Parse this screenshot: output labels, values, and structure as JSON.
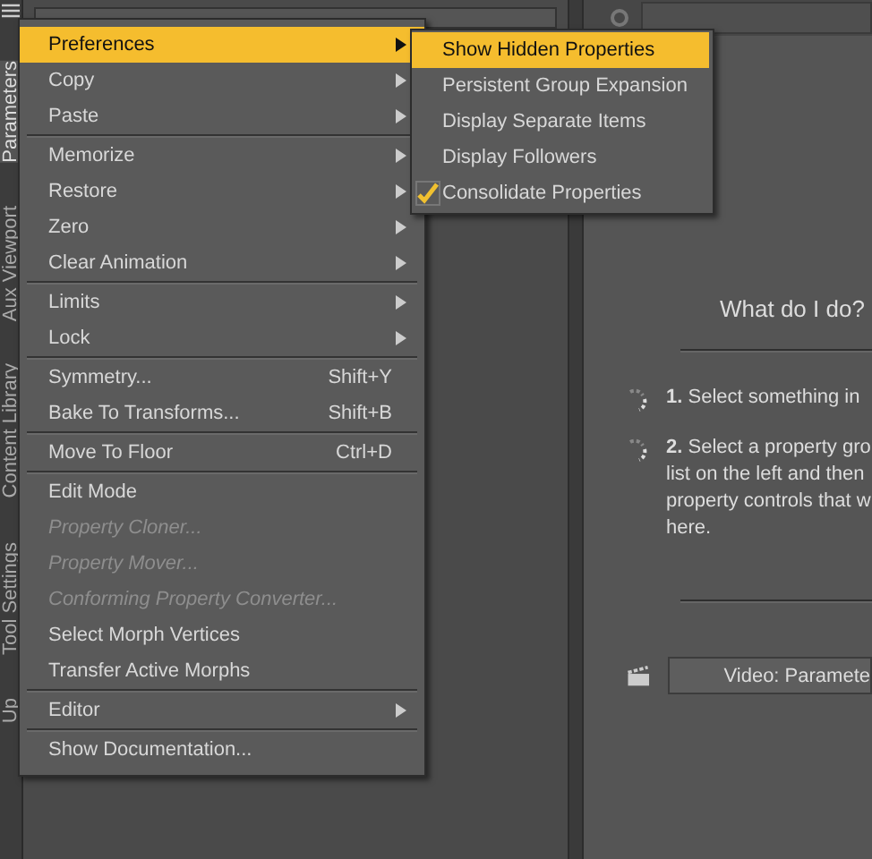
{
  "side_tabs": [
    {
      "label": "Parameters",
      "selected": true
    },
    {
      "label": "Aux Viewport",
      "selected": false
    },
    {
      "label": "Content Library",
      "selected": false
    },
    {
      "label": "Tool Settings",
      "selected": false
    },
    {
      "label": "Up",
      "selected": false
    }
  ],
  "menu": [
    {
      "kind": "item",
      "label": "Preferences",
      "submenu": true,
      "selected": true,
      "disabled": false
    },
    {
      "kind": "item",
      "label": "Copy",
      "submenu": true,
      "selected": false,
      "disabled": false
    },
    {
      "kind": "item",
      "label": "Paste",
      "submenu": true,
      "selected": false,
      "disabled": false
    },
    {
      "kind": "separator"
    },
    {
      "kind": "item",
      "label": "Memorize",
      "submenu": true,
      "selected": false,
      "disabled": false
    },
    {
      "kind": "item",
      "label": "Restore",
      "submenu": true,
      "selected": false,
      "disabled": false
    },
    {
      "kind": "item",
      "label": "Zero",
      "submenu": true,
      "selected": false,
      "disabled": false
    },
    {
      "kind": "item",
      "label": "Clear Animation",
      "submenu": true,
      "selected": false,
      "disabled": false
    },
    {
      "kind": "separator"
    },
    {
      "kind": "item",
      "label": "Limits",
      "submenu": true,
      "selected": false,
      "disabled": false
    },
    {
      "kind": "item",
      "label": "Lock",
      "submenu": true,
      "selected": false,
      "disabled": false
    },
    {
      "kind": "separator"
    },
    {
      "kind": "item",
      "label": "Symmetry...",
      "shortcut": "Shift+Y",
      "submenu": false,
      "selected": false,
      "disabled": false
    },
    {
      "kind": "item",
      "label": "Bake To Transforms...",
      "shortcut": "Shift+B",
      "submenu": false,
      "selected": false,
      "disabled": false
    },
    {
      "kind": "separator"
    },
    {
      "kind": "item",
      "label": "Move To Floor",
      "shortcut": "Ctrl+D",
      "submenu": false,
      "selected": false,
      "disabled": false
    },
    {
      "kind": "separator"
    },
    {
      "kind": "item",
      "label": "Edit Mode",
      "submenu": false,
      "selected": false,
      "disabled": false
    },
    {
      "kind": "item",
      "label": "Property Cloner...",
      "submenu": false,
      "selected": false,
      "disabled": true
    },
    {
      "kind": "item",
      "label": "Property Mover...",
      "submenu": false,
      "selected": false,
      "disabled": true
    },
    {
      "kind": "item",
      "label": "Conforming Property Converter...",
      "submenu": false,
      "selected": false,
      "disabled": true
    },
    {
      "kind": "item",
      "label": "Select Morph Vertices",
      "submenu": false,
      "selected": false,
      "disabled": false
    },
    {
      "kind": "item",
      "label": "Transfer Active Morphs",
      "submenu": false,
      "selected": false,
      "disabled": false
    },
    {
      "kind": "separator"
    },
    {
      "kind": "item",
      "label": "Editor",
      "submenu": true,
      "selected": false,
      "disabled": false
    },
    {
      "kind": "separator"
    },
    {
      "kind": "item",
      "label": "Show Documentation...",
      "submenu": false,
      "selected": false,
      "disabled": false
    }
  ],
  "submenu": [
    {
      "label": "Show Hidden Properties",
      "checked": false,
      "selected": true
    },
    {
      "label": "Persistent Group Expansion",
      "checked": false,
      "selected": false
    },
    {
      "label": "Display Separate Items",
      "checked": false,
      "selected": false
    },
    {
      "label": "Display Followers",
      "checked": false,
      "selected": false
    },
    {
      "label": "Consolidate Properties",
      "checked": true,
      "selected": false
    }
  ],
  "help": {
    "title": "What do I do?",
    "steps": [
      {
        "lines": [
          "**1.** Select something in"
        ]
      },
      {
        "lines": [
          "**2.** Select a property gro",
          "list on the left and then",
          "property controls that w",
          "here."
        ]
      }
    ],
    "video_button": "Video: Paramete"
  }
}
